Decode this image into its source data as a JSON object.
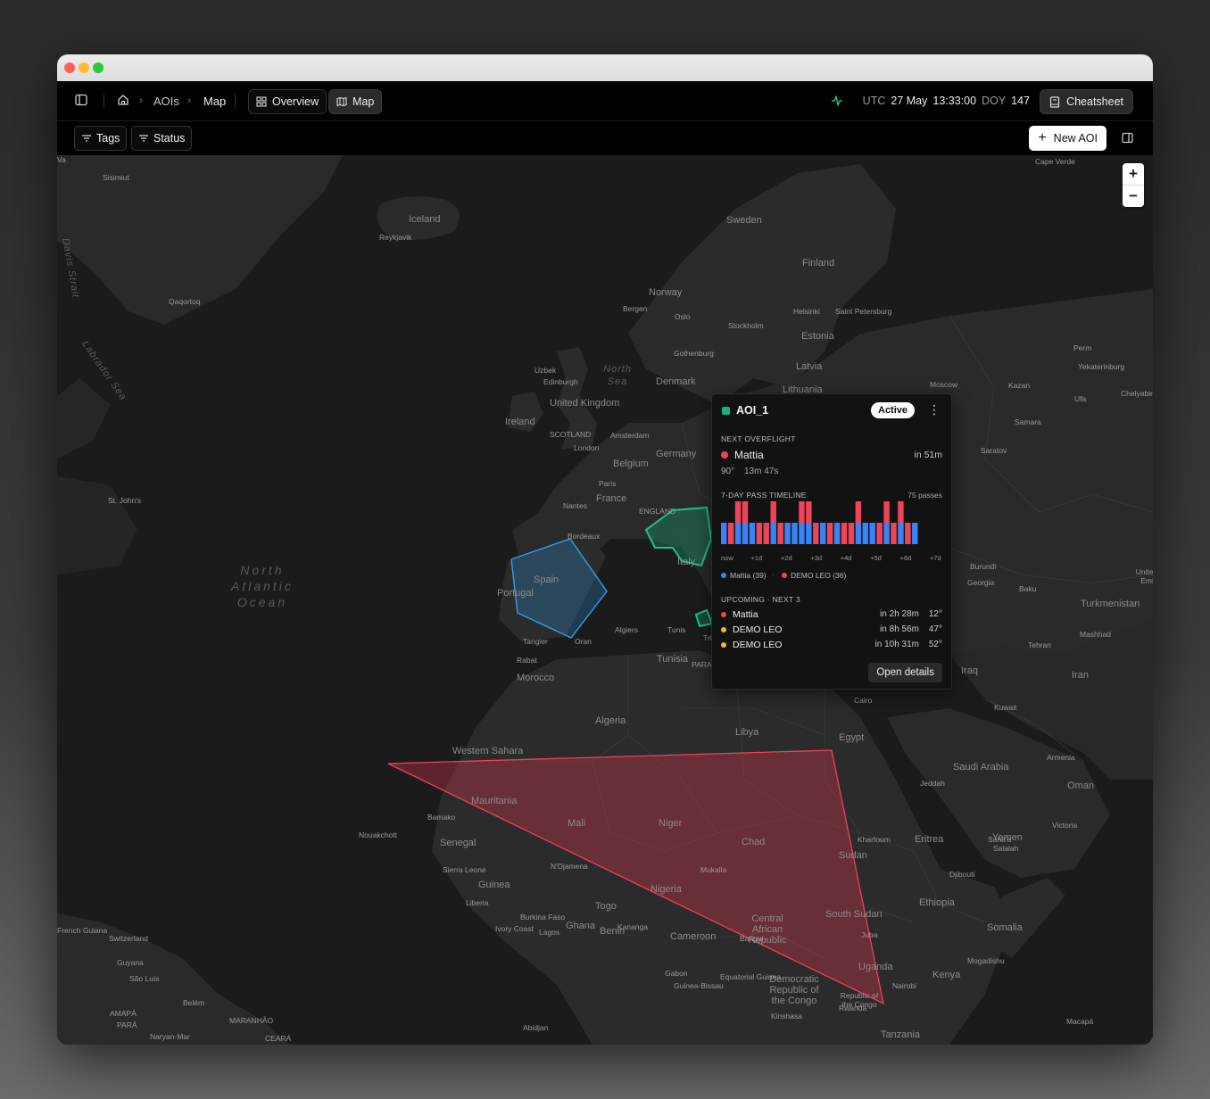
{
  "window": {
    "traffic_lights": [
      "close",
      "minimize",
      "zoom"
    ]
  },
  "topbar": {
    "breadcrumb": {
      "home_icon": "home-icon",
      "items": [
        "AOIs",
        "Map"
      ]
    },
    "tabs": [
      {
        "label": "Overview",
        "icon": "grid-icon"
      },
      {
        "label": "Map",
        "icon": "map-icon",
        "active": true
      }
    ],
    "clock": {
      "label": "UTC",
      "date": "27 May",
      "time": "13:33:00",
      "doy_label": "DOY",
      "doy": "147"
    },
    "cheatsheet_label": "Cheatsheet"
  },
  "filters": {
    "tags_label": "Tags",
    "status_label": "Status",
    "new_aoi_label": "New AOI"
  },
  "map": {
    "zoom_in": "+",
    "zoom_out": "−",
    "labels": {
      "oceans": [
        "North\nAtlantic\nOcean"
      ],
      "seas": [
        "North Sea",
        "Davis Strait",
        "Labrador Sea"
      ],
      "countries": [
        "Iceland",
        "Sweden",
        "Finland",
        "Norway",
        "Denmark",
        "Ireland",
        "United Kingdom",
        "Germany",
        "France",
        "Spain",
        "Portugal",
        "Italy",
        "Morocco",
        "Algeria",
        "Tunisia",
        "Libya",
        "Egypt",
        "Mauritania",
        "Mali",
        "Niger",
        "Chad",
        "Sudan",
        "South Sudan",
        "Nigeria",
        "Cameroon",
        "Saudi Arabia",
        "Iran",
        "Iraq",
        "Turkmenistan",
        "Ethiopia",
        "Somalia",
        "Kenya",
        "Yemen",
        "Oman",
        "Tanzania",
        "Democratic Republic of the Congo",
        "Central African Republic",
        "Estonia",
        "Latvia",
        "Lithuania",
        "Belgium",
        "Senegal",
        "Guinea",
        "Benin",
        "Togo",
        "Ghana",
        "Uganda",
        "Eritrea",
        "Western Sahara"
      ],
      "cities": [
        "Sisimiut",
        "Reykjavik",
        "Qaqortoq",
        "Bergen",
        "Oslo",
        "Stockholm",
        "Helsinki",
        "Saint Petersburg",
        "Gothenburg",
        "Edinburgh",
        "London",
        "Amsterdam",
        "Paris",
        "Nantes",
        "Bordeaux",
        "Tangier",
        "Oran",
        "Algiers",
        "Tunis",
        "Rabat",
        "St. John's",
        "Moscow",
        "Kazan",
        "Perm",
        "Yekaterinburg",
        "Chelyabinsk",
        "Ufa",
        "Samara",
        "Saratov",
        "Baku",
        "Tehran",
        "Mashhad",
        "Kuwait",
        "Cairo",
        "Jeddah",
        "Khartoum",
        "Sana'a",
        "Djibouti",
        "Mogadishu",
        "Nairobi",
        "Juba",
        "Bangui",
        "Kinshasa",
        "Kananga",
        "Lagos",
        "Abidjan",
        "Bamako",
        "Nouakchott",
        "Cape Verde",
        "Naryan-Mar",
        "Belém",
        "São Luís",
        "Macapá",
        "Victoria",
        "Salalah",
        "Mukalla",
        "N'Djamena",
        "Burkina Faso",
        "Ivory Coast",
        "Liberia",
        "Sierra Leone",
        "Guinea-Bissau",
        "Gabon",
        "Equatorial Guinea",
        "Republic of the Congo",
        "Rwanda",
        "Burundi",
        "Georgia",
        "Armenia",
        "United Arab Emirates",
        "Uzbek",
        "SCOTLAND",
        "ENGLAND",
        "Switzerland",
        "French Guiana",
        "Guyana",
        "AMAPÁ",
        "PARÁ",
        "MARANHÃO",
        "CEARÁ",
        "PARAÍBA",
        "Tripoli",
        "Va"
      ]
    }
  },
  "popup": {
    "aoi_name": "AOI_1",
    "status": "Active",
    "next_overflight_title": "NEXT OVERFLIGHT",
    "next": {
      "satellite": "Mattia",
      "eta": "in 51m",
      "elevation": "90°",
      "duration": "13m 47s"
    },
    "timeline_title": "7-DAY PASS TIMELINE",
    "timeline_count": "75 passes",
    "timeline_ticks": [
      "now",
      "+1d",
      "+2d",
      "+3d",
      "+4d",
      "+5d",
      "+6d",
      "+7d"
    ],
    "legend": [
      {
        "name": "Mattia (39)",
        "color": "#3b82f6"
      },
      {
        "name": "DEMO LEO (36)",
        "color": "#ef4458"
      }
    ],
    "upcoming_title": "UPCOMING · NEXT 3",
    "upcoming": [
      {
        "name": "Mattia",
        "eta": "in 2h 28m",
        "elev": "12°",
        "color": "#ef4458"
      },
      {
        "name": "DEMO LEO",
        "eta": "in 8h 56m",
        "elev": "47°",
        "color": "#f5b82e"
      },
      {
        "name": "DEMO LEO",
        "eta": "in 10h 31m",
        "elev": "52°",
        "color": "#f5b82e"
      }
    ],
    "open_details_label": "Open details"
  },
  "chart_data": {
    "type": "bar",
    "title": "7-DAY PASS TIMELINE",
    "categories": [
      "1",
      "2",
      "3",
      "4",
      "5",
      "6",
      "7",
      "8",
      "9",
      "10",
      "11",
      "12",
      "13",
      "14",
      "15",
      "16",
      "17",
      "18",
      "19",
      "20",
      "21",
      "22",
      "23",
      "24",
      "25",
      "26",
      "27",
      "28"
    ],
    "series": [
      {
        "name": "Mattia",
        "color": "#3b82f6",
        "values": [
          1,
          0,
          1,
          1,
          1,
          0,
          0,
          1,
          0,
          1,
          1,
          1,
          1,
          0,
          1,
          0,
          1,
          0,
          0,
          1,
          1,
          1,
          0,
          1,
          0,
          1,
          0,
          1
        ]
      },
      {
        "name": "DEMO LEO",
        "color": "#ef4458",
        "values": [
          0,
          1,
          1,
          1,
          0,
          1,
          1,
          1,
          1,
          0,
          0,
          1,
          1,
          1,
          0,
          1,
          0,
          1,
          1,
          1,
          0,
          0,
          1,
          1,
          1,
          1,
          1,
          0
        ]
      }
    ],
    "colors": {
      "Mattia": "#3b82f6",
      "DEMO LEO": "#ef4458"
    },
    "grid": false
  }
}
